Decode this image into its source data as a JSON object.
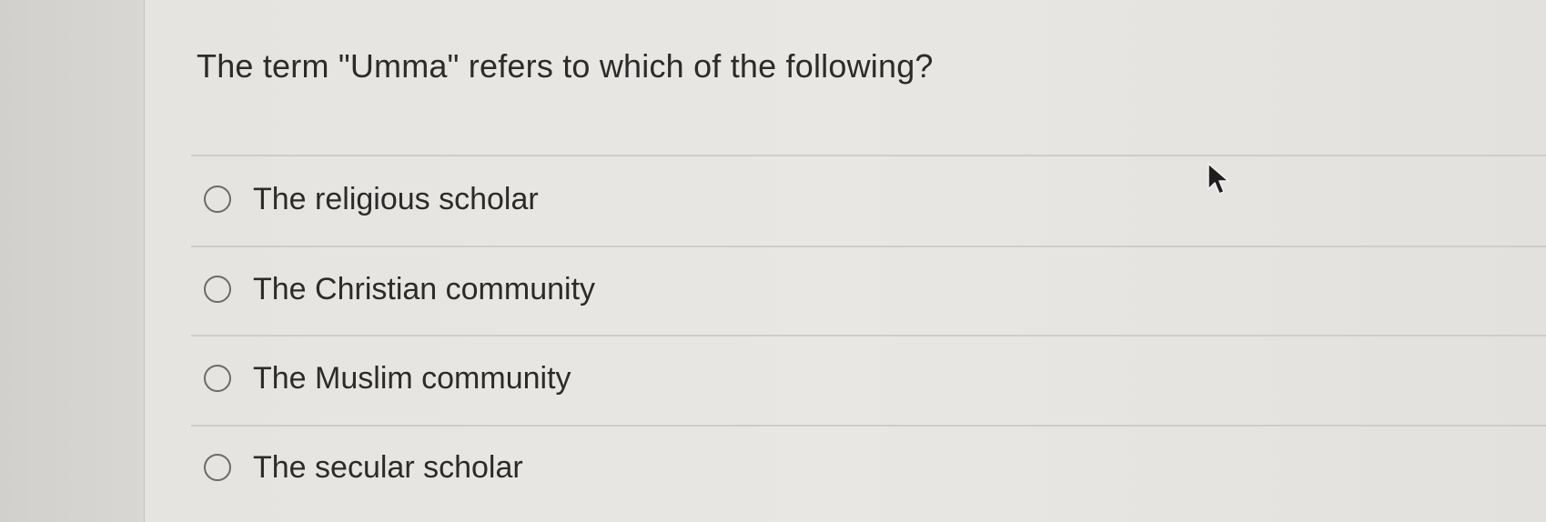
{
  "question": {
    "text": "The term \"Umma\" refers to which of the following?"
  },
  "options": [
    {
      "label": "The religious scholar",
      "selected": false
    },
    {
      "label": "The Christian community",
      "selected": false
    },
    {
      "label": "The Muslim community",
      "selected": false
    },
    {
      "label": "The secular scholar",
      "selected": false
    }
  ],
  "colors": {
    "text": "#2b2b2b",
    "radio_border": "#6a6a6a",
    "divider": "#cfcdc9",
    "panel_bg": "#e8e6e2"
  },
  "icons": {
    "pointer": "mouse-pointer-icon"
  }
}
